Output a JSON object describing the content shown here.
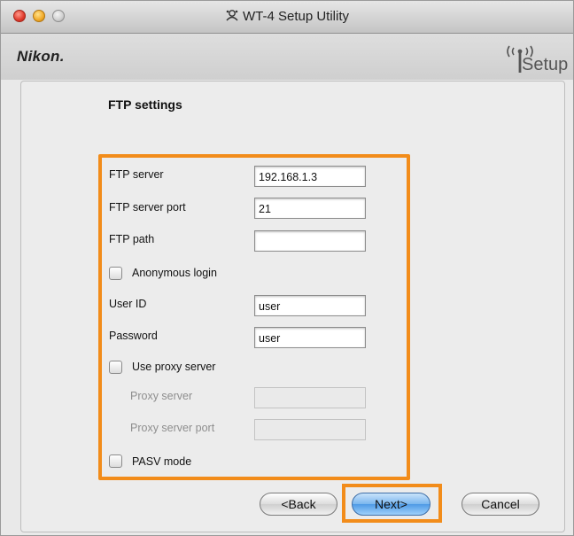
{
  "window": {
    "title": "WT-4 Setup Utility",
    "brand": "Nikon.",
    "setup_logo_text": "Setup",
    "title_icon": "network-icon"
  },
  "page": {
    "section_title": "FTP settings"
  },
  "form": {
    "ftp_server": {
      "label": "FTP server",
      "value": "192.168.1.3"
    },
    "ftp_server_port": {
      "label": "FTP server port",
      "value": "21"
    },
    "ftp_path": {
      "label": "FTP path",
      "value": ""
    },
    "anonymous_login": {
      "label": "Anonymous login",
      "checked": false
    },
    "user_id": {
      "label": "User ID",
      "value": "user"
    },
    "password": {
      "label": "Password",
      "value": "user"
    },
    "use_proxy_server": {
      "label": "Use proxy server",
      "checked": false
    },
    "proxy_server": {
      "label": "Proxy server",
      "value": "",
      "enabled": false
    },
    "proxy_server_port": {
      "label": "Proxy server port",
      "value": "",
      "enabled": false
    },
    "pasv_mode": {
      "label": "PASV mode",
      "checked": false
    }
  },
  "buttons": {
    "back": "<Back",
    "next": "Next>",
    "cancel": "Cancel"
  },
  "colors": {
    "highlight": "#f28c1a",
    "primary_button": "#5aa2ea"
  }
}
